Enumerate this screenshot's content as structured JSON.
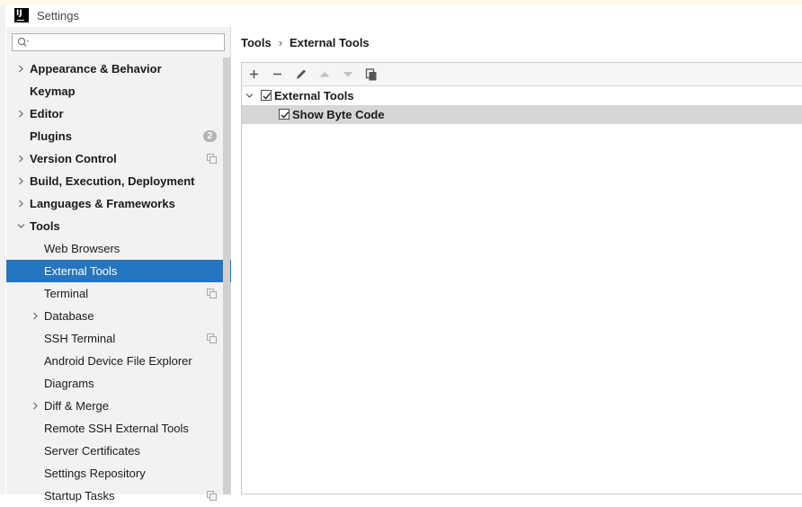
{
  "window": {
    "title": "Settings",
    "logo_text": "IJ"
  },
  "search": {
    "placeholder": "",
    "value": ""
  },
  "sidebar": {
    "items": [
      {
        "label": "Appearance & Behavior",
        "level": 0,
        "bold": true,
        "expander": "collapsed"
      },
      {
        "label": "Keymap",
        "level": 0,
        "bold": true,
        "expander": "none"
      },
      {
        "label": "Editor",
        "level": 0,
        "bold": true,
        "expander": "collapsed"
      },
      {
        "label": "Plugins",
        "level": 0,
        "bold": true,
        "expander": "none",
        "badge": "2"
      },
      {
        "label": "Version Control",
        "level": 0,
        "bold": true,
        "expander": "collapsed",
        "project_icon": true
      },
      {
        "label": "Build, Execution, Deployment",
        "level": 0,
        "bold": true,
        "expander": "collapsed"
      },
      {
        "label": "Languages & Frameworks",
        "level": 0,
        "bold": true,
        "expander": "collapsed"
      },
      {
        "label": "Tools",
        "level": 0,
        "bold": true,
        "expander": "expanded"
      },
      {
        "label": "Web Browsers",
        "level": 1,
        "bold": false,
        "expander": "none"
      },
      {
        "label": "External Tools",
        "level": 1,
        "bold": false,
        "expander": "none",
        "selected": true
      },
      {
        "label": "Terminal",
        "level": 1,
        "bold": false,
        "expander": "none",
        "project_icon": true
      },
      {
        "label": "Database",
        "level": 1,
        "bold": false,
        "expander": "collapsed"
      },
      {
        "label": "SSH Terminal",
        "level": 1,
        "bold": false,
        "expander": "none",
        "project_icon": true
      },
      {
        "label": "Android Device File Explorer",
        "level": 1,
        "bold": false,
        "expander": "none"
      },
      {
        "label": "Diagrams",
        "level": 1,
        "bold": false,
        "expander": "none"
      },
      {
        "label": "Diff & Merge",
        "level": 1,
        "bold": false,
        "expander": "collapsed"
      },
      {
        "label": "Remote SSH External Tools",
        "level": 1,
        "bold": false,
        "expander": "none"
      },
      {
        "label": "Server Certificates",
        "level": 1,
        "bold": false,
        "expander": "none"
      },
      {
        "label": "Settings Repository",
        "level": 1,
        "bold": false,
        "expander": "none"
      },
      {
        "label": "Startup Tasks",
        "level": 1,
        "bold": false,
        "expander": "none",
        "project_icon": true
      }
    ]
  },
  "breadcrumb": {
    "parent": "Tools",
    "separator": "›",
    "current": "External Tools"
  },
  "toolbar": {
    "buttons": [
      {
        "icon": "add-icon",
        "enabled": true
      },
      {
        "icon": "remove-icon",
        "enabled": true
      },
      {
        "icon": "edit-icon",
        "enabled": true
      },
      {
        "icon": "move-up-icon",
        "enabled": false
      },
      {
        "icon": "move-down-icon",
        "enabled": false
      },
      {
        "icon": "copy-icon",
        "enabled": true
      }
    ]
  },
  "tools_tree": [
    {
      "label": "External Tools",
      "level": 0,
      "checked": true,
      "expander": "expanded"
    },
    {
      "label": "Show Byte Code",
      "level": 1,
      "checked": true,
      "selected": true
    }
  ],
  "colors": {
    "selection": "#2675bf",
    "sidebar_bg": "#f2f2f2",
    "row_selection": "#d6d6d6"
  }
}
